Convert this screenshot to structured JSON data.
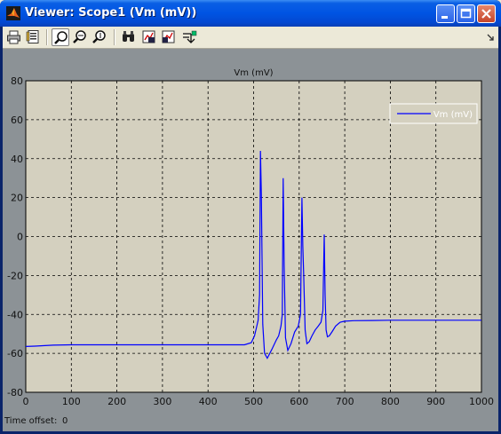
{
  "window": {
    "title": "Viewer: Scope1 (Vm (mV))"
  },
  "toolbar": {
    "tools": [
      {
        "name": "print-icon"
      },
      {
        "name": "parameters-icon"
      },
      {
        "name": "zoom-icon"
      },
      {
        "name": "zoom-x-icon"
      },
      {
        "name": "zoom-y-icon"
      },
      {
        "name": "autoscale-icon"
      },
      {
        "name": "save-axes-icon"
      },
      {
        "name": "restore-axes-icon"
      },
      {
        "name": "signal-selection-icon"
      }
    ]
  },
  "footer": {
    "time_offset_label": "Time offset:",
    "time_offset_value": "0"
  },
  "chart_data": {
    "type": "line",
    "title": "Vm (mV)",
    "xlabel": "",
    "ylabel": "",
    "xlim": [
      0,
      1000
    ],
    "ylim": [
      -80,
      80
    ],
    "xticks": [
      0,
      100,
      200,
      300,
      400,
      500,
      600,
      700,
      800,
      900,
      1000
    ],
    "yticks": [
      -80,
      -60,
      -40,
      -20,
      0,
      20,
      40,
      60,
      80
    ],
    "grid": true,
    "legend": "top-right",
    "background_color": "#d4d0bf",
    "series": [
      {
        "name": "Vm (mV)",
        "color": "#0000ff",
        "x": [
          0,
          20,
          60,
          100,
          200,
          300,
          400,
          480,
          495,
          502,
          506,
          510,
          513,
          515,
          517,
          520,
          524,
          530,
          540,
          550,
          555,
          560,
          563,
          565,
          567,
          570,
          575,
          582,
          590,
          598,
          603,
          606,
          608,
          610,
          613,
          617,
          622,
          628,
          635,
          642,
          648,
          652,
          655,
          657,
          659,
          662,
          666,
          672,
          680,
          690,
          700,
          720,
          760,
          800,
          900,
          1000
        ],
        "y": [
          -56.5,
          -56.3,
          -55.8,
          -55.6,
          -55.6,
          -55.6,
          -55.6,
          -55.6,
          -54.5,
          -51,
          -47,
          -43,
          -30,
          44,
          22,
          -45,
          -60,
          -62.5,
          -58,
          -53,
          -51,
          -46,
          -40,
          30,
          -15,
          -52,
          -58.5,
          -55,
          -49,
          -46,
          -40,
          20,
          -5,
          -20,
          -48,
          -55,
          -54,
          -51,
          -48,
          -46,
          -44,
          -38,
          1,
          -30,
          -48,
          -51.5,
          -51,
          -49,
          -46,
          -44,
          -43.5,
          -43.2,
          -43.1,
          -43.0,
          -43.0,
          -43.0
        ]
      }
    ]
  },
  "colors": {
    "titlebar": "#0054e3",
    "frame": "#ece9d8",
    "scope_background": "#8c9296",
    "axes_background": "#d4d0bf",
    "trace": "#0000ff"
  }
}
